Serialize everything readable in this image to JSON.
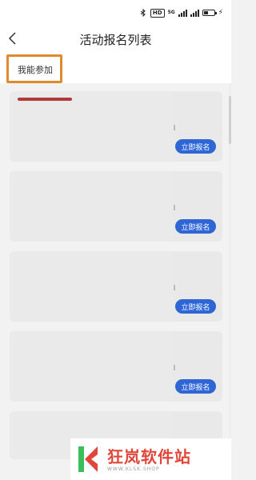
{
  "status_bar": {
    "hd_badge": "HD",
    "network_label": "5G"
  },
  "nav": {
    "title": "活动报名列表"
  },
  "tabs": [
    {
      "label": "我能参加",
      "highlighted": true
    }
  ],
  "activities": [
    {
      "button_label": "立即报名"
    },
    {
      "button_label": "立即报名"
    },
    {
      "button_label": "立即报名"
    },
    {
      "button_label": "立即报名"
    }
  ],
  "watermark": {
    "name": "狂岚软件站",
    "url": "WWW.KLSK.SHOP"
  },
  "colors": {
    "accent_button": "#2f66d6",
    "tab_highlight": "#e08a2e",
    "watermark_red": "#e2463a"
  }
}
